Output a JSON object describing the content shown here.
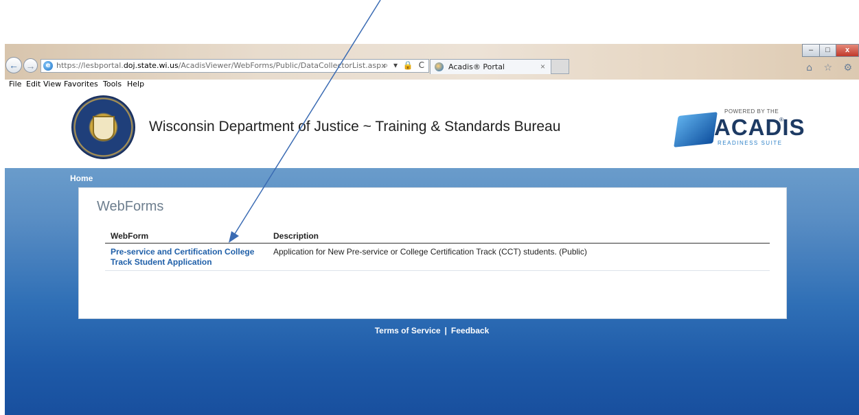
{
  "browser": {
    "url_prefix": "https://lesbportal.",
    "url_domain": "doj.state.wi.us",
    "url_path": "/AcadisViewer/WebForms/Public/DataCollectorList.aspx",
    "tab_title": "Acadis® Portal",
    "tab_close": "×",
    "back_glyph": "←",
    "forward_glyph": "→",
    "address_icons": "⌕ ▾ 🔒 C",
    "toolbar_icons": "⌂ ☆ ⚙",
    "window": {
      "minimize": "–",
      "maximize": "□",
      "close": "x"
    },
    "menu": [
      "File",
      "Edit",
      "View",
      "Favorites",
      "Tools",
      "Help"
    ]
  },
  "header": {
    "site_title": "Wisconsin Department of Justice ~ Training & Standards Bureau",
    "logo_powered_by": "POWERED BY THE",
    "logo_word": "ACADIS",
    "logo_reg": "®",
    "logo_sub": "READINESS SUITE"
  },
  "nav": {
    "home": "Home"
  },
  "main": {
    "title": "WebForms",
    "columns": {
      "webform": "WebForm",
      "description": "Description"
    },
    "rows": [
      {
        "webform": "Pre-service and Certification College Track Student Application",
        "description": "Application for New Pre-service or College Certification Track (CCT) students. (Public)"
      }
    ]
  },
  "footer": {
    "terms": "Terms of Service",
    "separator": "|",
    "feedback": "Feedback"
  },
  "colors": {
    "link": "#1f5fa8",
    "blue_band": "#2f6fb6",
    "annotation_arrow": "#3a6bb3"
  }
}
